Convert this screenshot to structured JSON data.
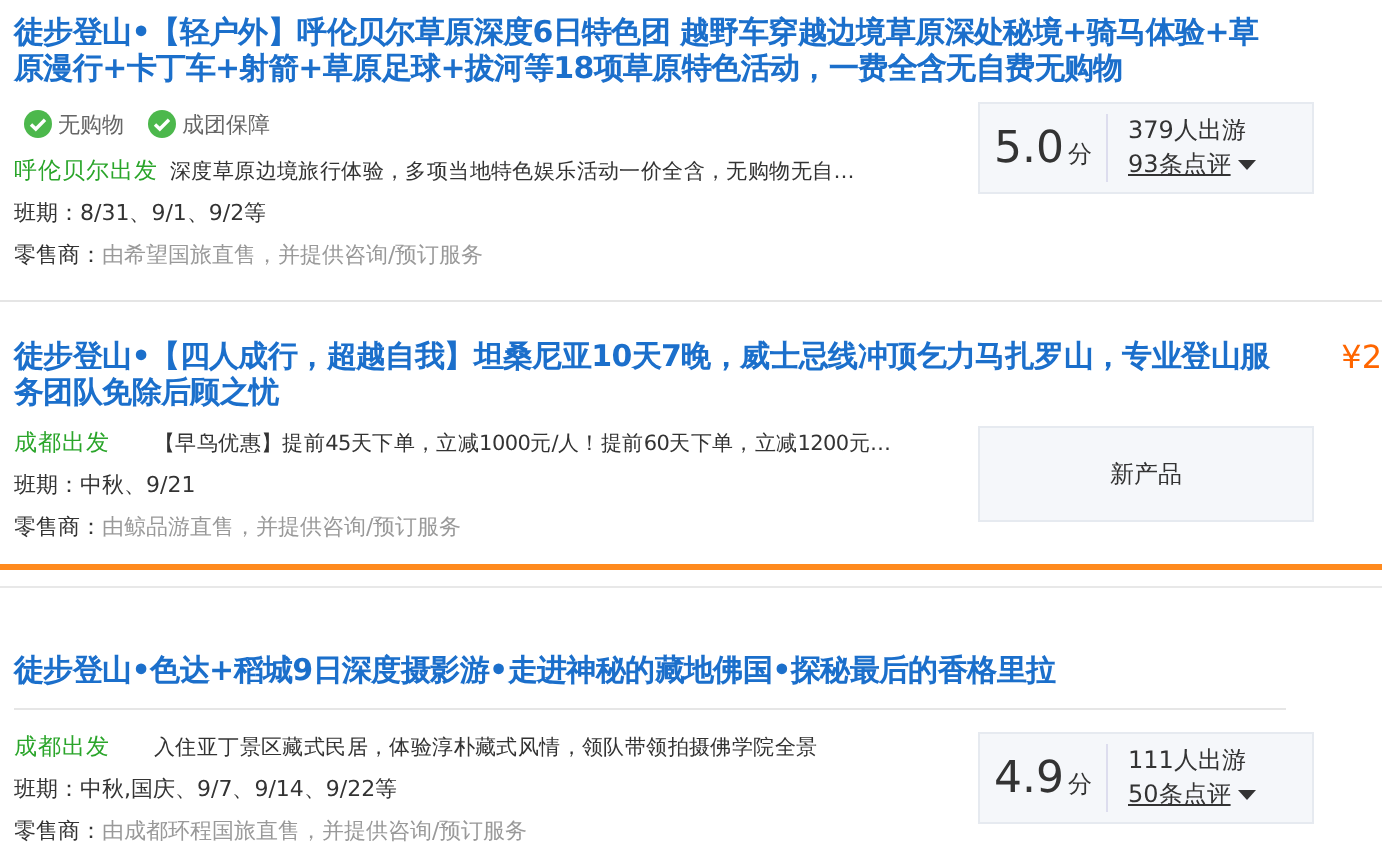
{
  "cards": [
    {
      "title": "徒步登山•【轻户外】呼伦贝尔草原深度6日特色团 越野车穿越边境草原深处秘境+骑马体验+草原漫行+卡丁车+射箭+草原足球+拔河等18项草原特色活动，一费全含无自费无购物",
      "title_divider": false,
      "tags": [
        "无购物",
        "成团保障"
      ],
      "departure": "呼伦贝尔出发",
      "description": "深度草原边境旅行体验，多项当地特色娱乐活动一价全含，无购物无自…",
      "schedule_label": "班期：",
      "schedule": "8/31、9/1、9/2等",
      "retailer_label": "零售商：",
      "retailer": "由希望国旅直售，并提供咨询/预订服务",
      "rating": {
        "kind": "score",
        "score": "5.0",
        "unit": "分",
        "travelers": "379人出游",
        "reviews": "93条点评"
      },
      "highlight_divider": false
    },
    {
      "title": "徒步登山•【四人成行，超越自我】坦桑尼亚10天7晚，威士忌线冲顶乞力马扎罗山，专业登山服务团队免除后顾之忧",
      "title_divider": false,
      "price": "¥2",
      "departure": "成都出发",
      "description": "【早鸟优惠】提前45天下单，立减1000元/人！提前60天下单，立减1200元…",
      "schedule_label": "班期：",
      "schedule": "中秋、9/21",
      "retailer_label": "零售商：",
      "retailer": "由鲸品游直售，并提供咨询/预订服务",
      "rating": {
        "kind": "new",
        "text": "新产品"
      },
      "highlight_divider": true
    },
    {
      "title": "徒步登山•色达+稻城9日深度摄影游•走进神秘的藏地佛国•探秘最后的香格里拉",
      "title_divider": true,
      "departure": "成都出发",
      "description": "入住亚丁景区藏式民居，体验淳朴藏式风情，领队带领拍摄佛学院全景",
      "schedule_label": "班期：",
      "schedule": "中秋,国庆、9/7、9/14、9/22等",
      "retailer_label": "零售商：",
      "retailer": "由成都环程国旅直售，并提供咨询/预订服务",
      "rating": {
        "kind": "score",
        "score": "4.9",
        "unit": "分",
        "travelers": "111人出游",
        "reviews": "50条点评"
      }
    }
  ]
}
